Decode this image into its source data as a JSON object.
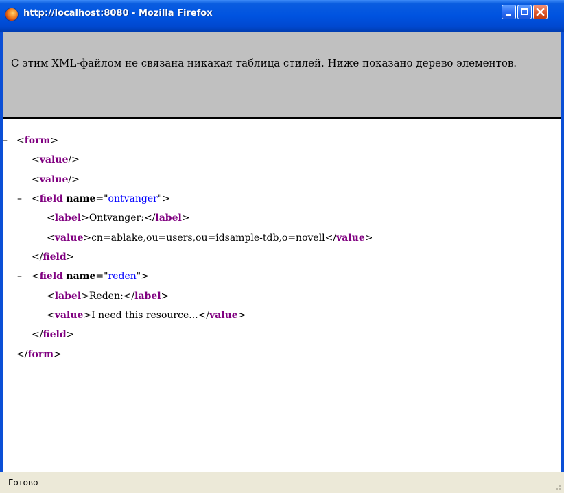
{
  "window": {
    "title": "http://localhost:8080 - Mozilla Firefox",
    "icon": "firefox-icon",
    "controls": [
      "minimize-icon",
      "maximize-icon",
      "close-icon"
    ]
  },
  "info": {
    "message": "С этим XML-файлом не связана никакая таблица стилей. Ниже показано дерево элементов."
  },
  "xml": {
    "collapse_symbol": "–",
    "form_tag": "form",
    "value_tag": "value",
    "field_tag": "field",
    "label_tag": "label",
    "name_attr": "name",
    "field1_name": "ontvanger",
    "field1_label": "Ontvanger:",
    "field1_value": "cn=ablake,ou=users,ou=idsample-tdb,o=novell",
    "field2_name": "reden",
    "field2_label": "Reden:",
    "field2_value": "I need this resource..."
  },
  "status": {
    "text": "Готово"
  },
  "colors": {
    "titlebar": "#0053e0",
    "window_border": "#0b4fd6",
    "info_bg": "#c0c0c0",
    "tag": "#800080",
    "attr_value": "#0000ff"
  }
}
